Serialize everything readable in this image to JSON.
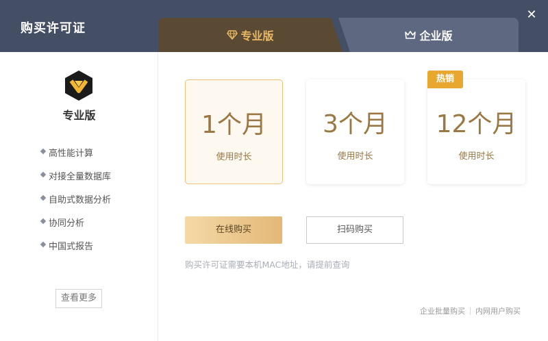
{
  "window": {
    "title": "购买许可证"
  },
  "tabs": [
    {
      "label": "专业版",
      "icon": "diamond-icon",
      "active": true
    },
    {
      "label": "企业版",
      "icon": "crown-icon",
      "active": false
    }
  ],
  "sidebar": {
    "edition": "专业版",
    "features": [
      "高性能计算",
      "对接全量数据库",
      "自助式数据分析",
      "协同分析",
      "中国式报告"
    ],
    "more_label": "查看更多"
  },
  "plans": [
    {
      "duration": "1个月",
      "label": "使用时长",
      "selected": true
    },
    {
      "duration": "3个月",
      "label": "使用时长",
      "selected": false
    },
    {
      "duration": "12个月",
      "label": "使用时长",
      "selected": false,
      "badge": "热销"
    }
  ],
  "actions": {
    "online": "在线购买",
    "scan": "扫码购买"
  },
  "note": "购买许可证需要本机MAC地址，请提前查询",
  "links": {
    "bulk": "企业批量购买",
    "intranet": "内网用户购买"
  },
  "colors": {
    "header": "#444e64",
    "gold": "#9a7743",
    "badge": "#e8a830",
    "tab_active_bg": "#5a4a34",
    "tab_active_text": "#e8b865"
  }
}
